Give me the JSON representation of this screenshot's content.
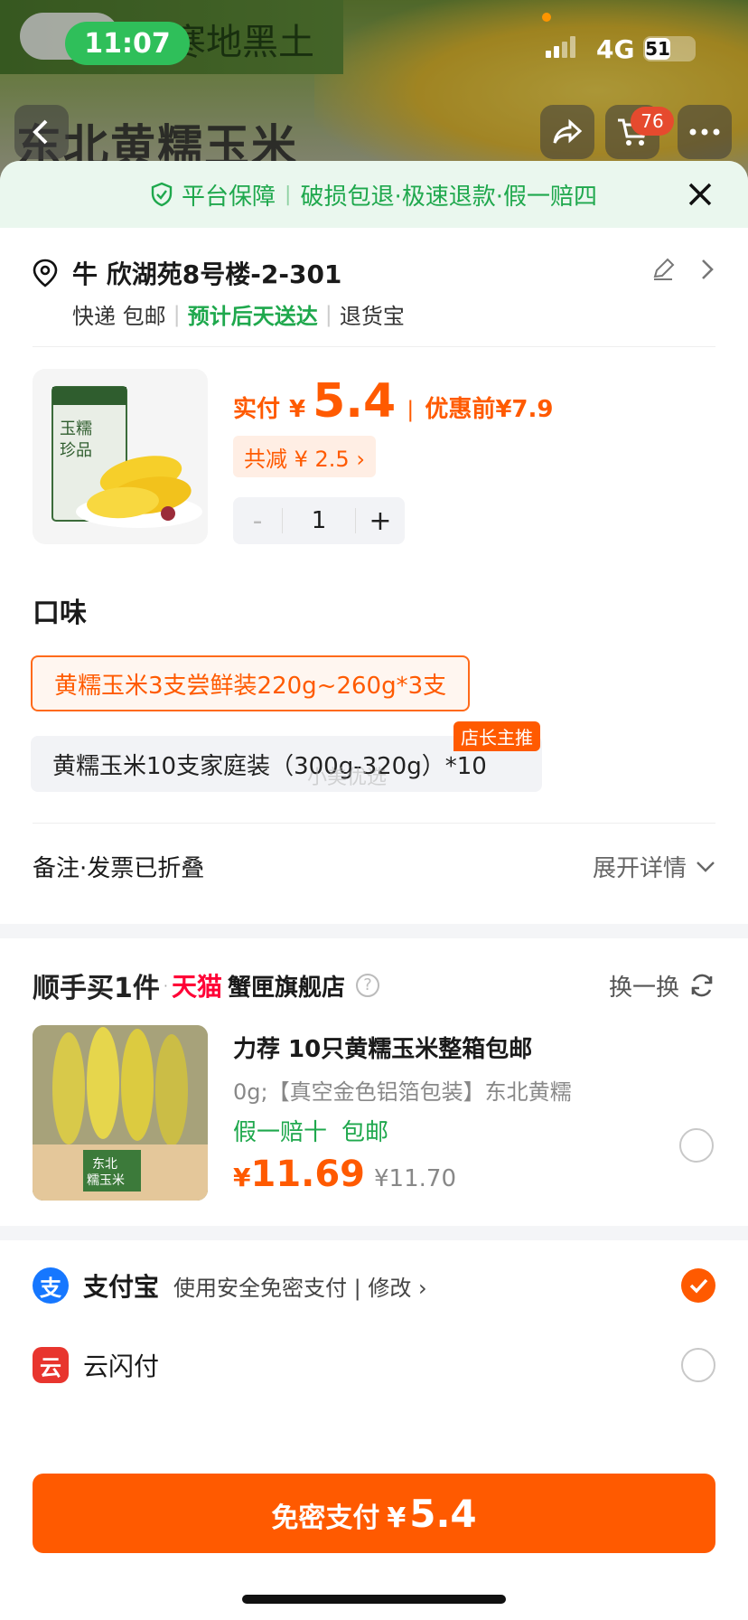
{
  "status_bar": {
    "time": "11:07",
    "network": "4G",
    "battery": "51"
  },
  "background": {
    "brand_text": "寒地黑土",
    "product_title": "东北黄糯玉米",
    "cart_count": "76"
  },
  "guarantee": {
    "label": "平台保障",
    "text": "破损包退·极速退款·假一赔四"
  },
  "address": {
    "line": "牛 欣湖苑8号楼-2-301",
    "shipping": "快递 包邮",
    "delivery": "预计后天送达",
    "returns": "退货宝"
  },
  "product": {
    "pay_label": "实付",
    "currency": "¥",
    "price": "5.4",
    "orig_label": "优惠前",
    "orig_price": "¥7.9",
    "discount": "共减 ¥ 2.5 ›",
    "qty_minus": "-",
    "qty": "1",
    "qty_plus": "+"
  },
  "flavor": {
    "title": "口味",
    "options": [
      {
        "label": "黄糯玉米3支尝鲜装220g~260g*3支",
        "selected": true
      },
      {
        "label": "黄糯玉米10支家庭装（300g-320g）*10",
        "tag": "店长主推"
      }
    ],
    "watermark": "小美优选"
  },
  "remark": {
    "label": "备注·发票已折叠",
    "expand": "展开详情"
  },
  "recommend": {
    "title": "顺手买1件",
    "tmall": "天猫",
    "store": "蟹匣旗舰店",
    "help": "?",
    "swap": "换一换",
    "item": {
      "name": "力荐 10只黄糯玉米整箱包邮",
      "desc": "0g;【真空金色铝箔包装】东北黄糯",
      "tags": [
        "假一赔十",
        "包邮"
      ],
      "currency": "¥",
      "price": "11.69",
      "orig_price": "¥11.70",
      "box_label_1": "东北",
      "box_label_2": "糯玉米"
    }
  },
  "payment": {
    "methods": [
      {
        "icon": "支",
        "name": "支付宝",
        "sub": "使用安全免密支付 | 修改 ›",
        "selected": true
      },
      {
        "icon": "云",
        "name": "云闪付",
        "selected": false
      }
    ],
    "button_label": "免密支付",
    "button_currency": "¥",
    "button_amount": "5.4"
  },
  "colors": {
    "accent": "#ff5a00",
    "green": "#1fa84d",
    "tmall": "#ff0036"
  }
}
